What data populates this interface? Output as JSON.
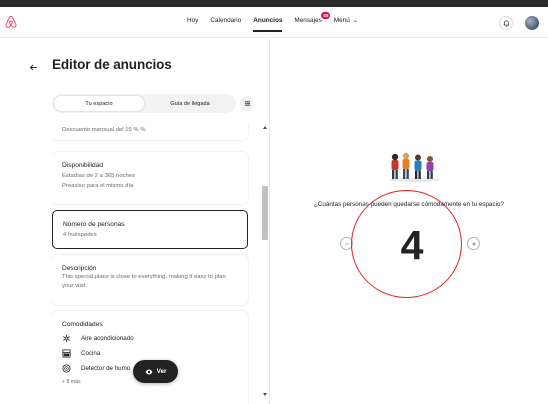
{
  "header": {
    "nav": [
      {
        "label": "Hoy"
      },
      {
        "label": "Calendario"
      },
      {
        "label": "Anuncios"
      },
      {
        "label": "Mensajes"
      },
      {
        "label": "Menú"
      }
    ],
    "messages_badge": "88"
  },
  "editor": {
    "title": "Editor de anuncios",
    "tabs": [
      "Tu espacio",
      "Guía de llegada"
    ]
  },
  "cards": {
    "discount": {
      "sub": "Descuento mensual del 15 % %"
    },
    "availability": {
      "title": "Disponibilidad",
      "lines": [
        "Estadías de 2 a 365 noches",
        "Preaviso para el mismo día"
      ]
    },
    "guests": {
      "title": "Número de personas",
      "sub": "4 huéspedes"
    },
    "description": {
      "title": "Descripción",
      "sub": "This special place is close to everything, making it easy to plan your visit."
    },
    "amenities": {
      "title": "Comodidades",
      "items": [
        {
          "label": "Aire acondicionado",
          "icon": "snowflake-icon"
        },
        {
          "label": "Cocina",
          "icon": "kitchen-icon"
        },
        {
          "label": "Detector de humo",
          "icon": "smoke-detector-icon"
        }
      ],
      "more": "+ 8 más"
    }
  },
  "view_button": {
    "label": "Ver"
  },
  "panel": {
    "question": "¿Cuántas personas pueden quedarse cómodamente en tu espacio?",
    "count": "4"
  },
  "colors": {
    "badge": "#e00b41",
    "annotation_circle": "#e2231a",
    "brand": "#ff385c"
  }
}
